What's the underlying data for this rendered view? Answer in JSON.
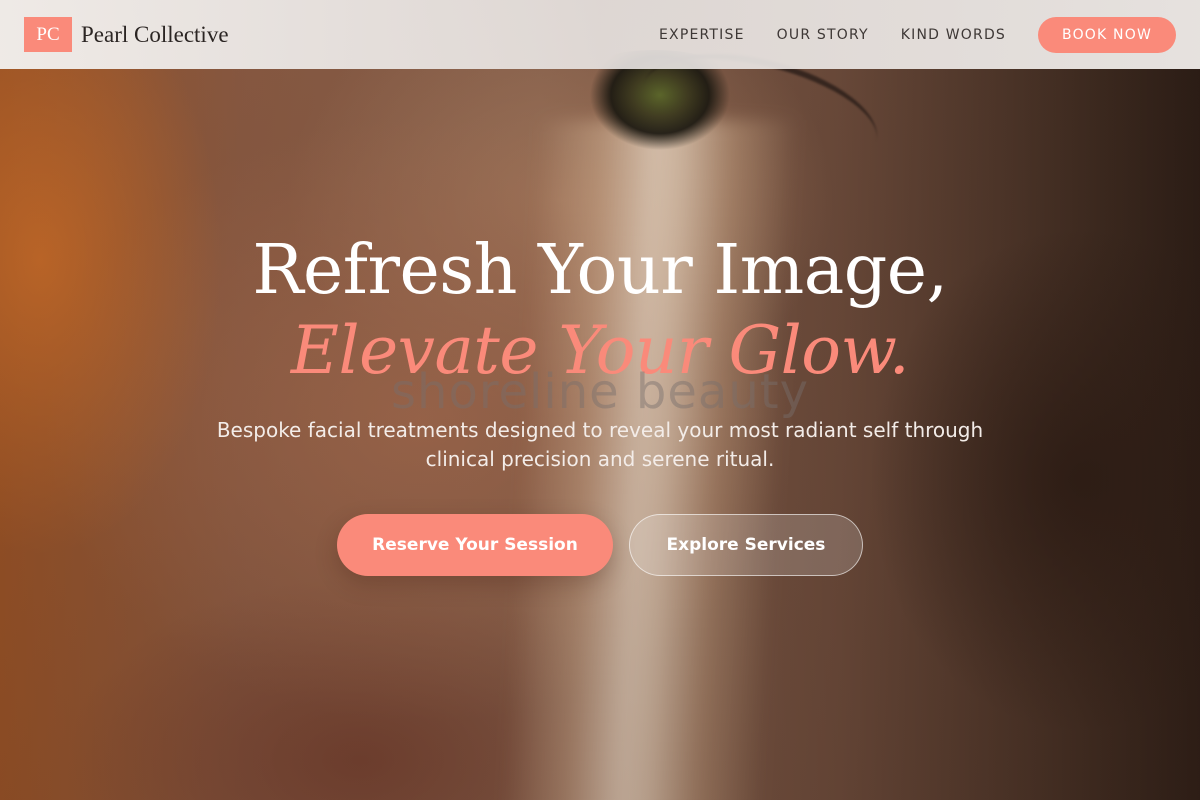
{
  "header": {
    "logo_mark": "PC",
    "brand_name": "Pearl Collective",
    "nav": [
      {
        "label": "EXPERTISE"
      },
      {
        "label": "OUR STORY"
      },
      {
        "label": "KIND WORDS"
      }
    ],
    "cta_label": "BOOK NOW"
  },
  "hero": {
    "headline_line1": "Refresh Your Image,",
    "headline_line2": "Elevate Your Glow.",
    "watermark": "shoreline beauty",
    "subtitle": "Bespoke facial treatments designed to reveal your most radiant self through clinical precision and serene ritual.",
    "primary_cta": "Reserve Your Session",
    "secondary_cta": "Explore Services"
  },
  "colors": {
    "accent": "#fa8a7a",
    "header_bg": "#efecea",
    "text_dark": "#2b2523",
    "hero_text": "#ffffff"
  }
}
